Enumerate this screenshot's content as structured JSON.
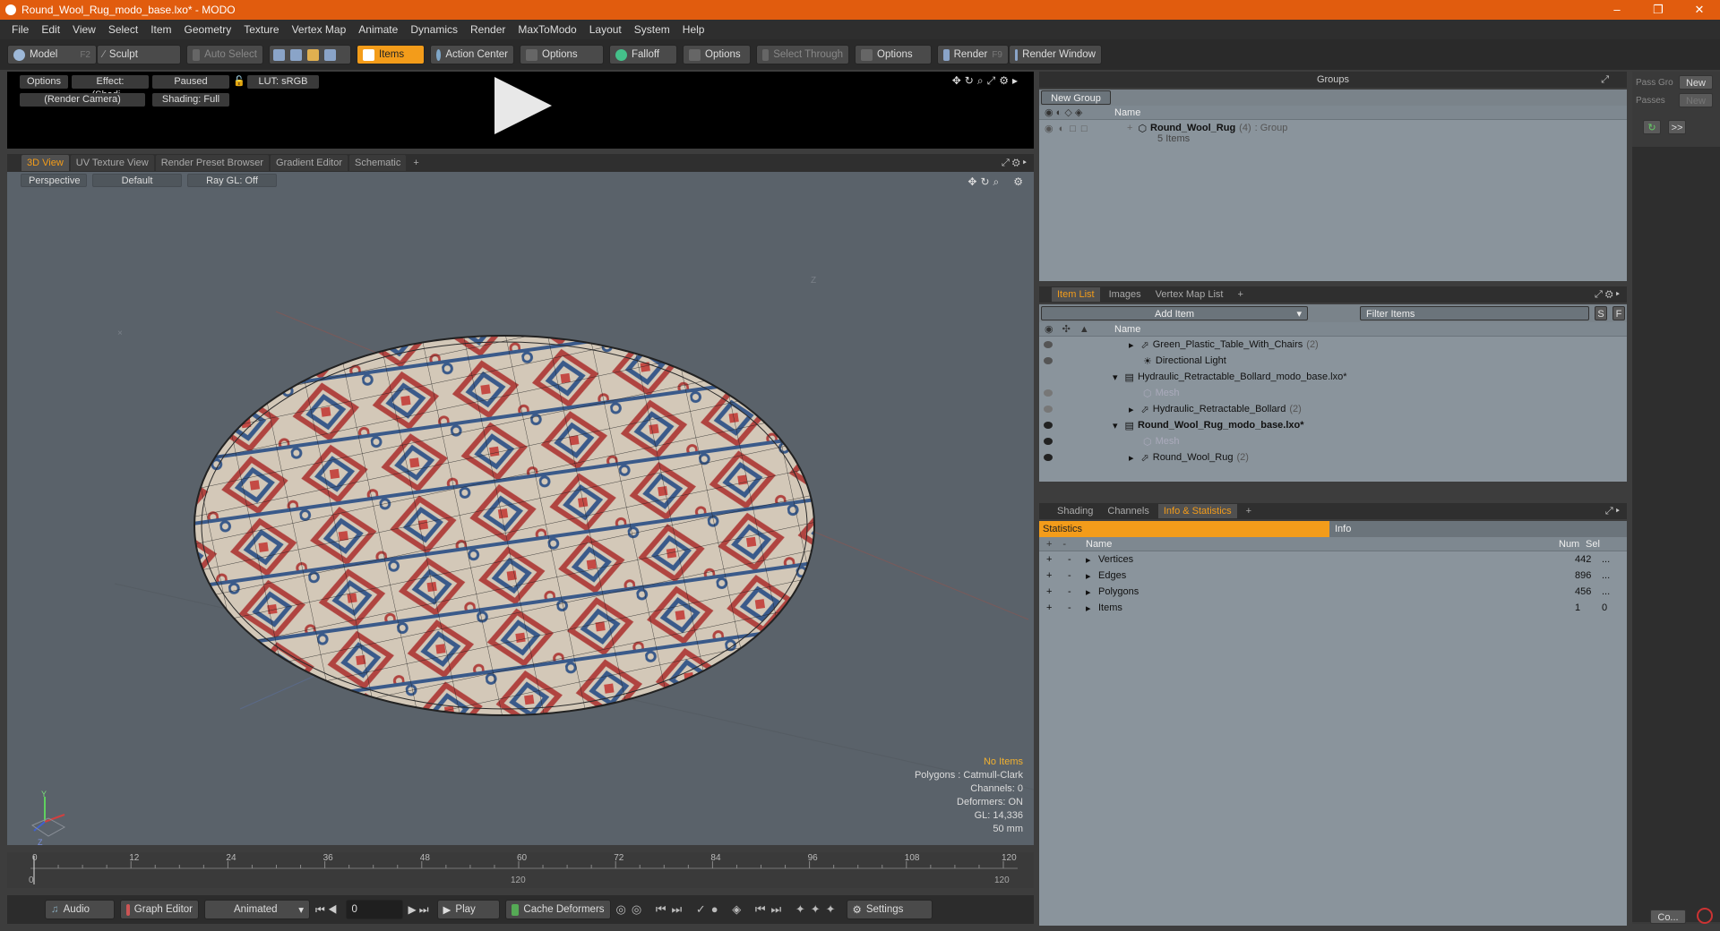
{
  "window": {
    "title": "Round_Wool_Rug_modo_base.lxo* - MODO",
    "minimize": "–",
    "maximize": "❐",
    "close": "✕"
  },
  "menu": [
    "File",
    "Edit",
    "View",
    "Select",
    "Item",
    "Geometry",
    "Texture",
    "Vertex Map",
    "Animate",
    "Dynamics",
    "Render",
    "MaxToModo",
    "Layout",
    "System",
    "Help"
  ],
  "toolbar": {
    "model": "Model",
    "model_key": "F2",
    "sculpt": "Sculpt",
    "auto_select": "Auto Select",
    "items": "Items",
    "action_center": "Action Center",
    "options1": "Options",
    "falloff": "Falloff",
    "options2": "Options",
    "select_through": "Select Through",
    "options3": "Options",
    "render": "Render",
    "render_key": "F9",
    "render_window": "Render Window"
  },
  "preview": {
    "options": "Options",
    "effect": "Effect: (Shadi...",
    "paused": "Paused",
    "lut": "LUT: sRGB",
    "camera": "(Render Camera)",
    "shading": "Shading: Full"
  },
  "viewport_tabs": [
    "3D View",
    "UV Texture View",
    "Render Preset Browser",
    "Gradient Editor",
    "Schematic",
    "+"
  ],
  "viewport": {
    "perspective": "Perspective",
    "default": "Default",
    "raygl": "Ray GL: Off",
    "info": {
      "no_items": "No Items",
      "polygons": "Polygons : Catmull-Clark",
      "channels": "Channels: 0",
      "deformers": "Deformers: ON",
      "gl": "GL: 14,336",
      "focal": "50 mm"
    },
    "axis_y": "Y",
    "axis_z": "Z"
  },
  "timeline": {
    "ticks": [
      "0",
      "12",
      "24",
      "36",
      "48",
      "60",
      "72",
      "84",
      "96",
      "108",
      "120"
    ],
    "start": "0",
    "mid": "120",
    "end": "120"
  },
  "playbar": {
    "audio": "Audio",
    "graph_editor": "Graph Editor",
    "animated": "Animated",
    "frame": "0",
    "play": "Play",
    "cache": "Cache Deformers",
    "settings": "Settings"
  },
  "groups": {
    "title": "Groups",
    "new_group": "New Group",
    "col_name": "Name",
    "row_name": "Round_Wool_Rug",
    "row_count": "(4)",
    "row_type": ": Group",
    "row_sub": "5 Items"
  },
  "pass": {
    "pass_groups": "Pass Gro",
    "passes": "Passes",
    "new1": "New",
    "new2": "New",
    "arrows": ">>",
    "co": "Co..."
  },
  "item_list": {
    "tabs": [
      "Item List",
      "Images",
      "Vertex Map List",
      "+"
    ],
    "add_item": "Add Item",
    "filter": "Filter Items",
    "s": "S",
    "f": "F",
    "col_name": "Name",
    "rows": [
      {
        "label": "Green_Plastic_Table_With_Chairs",
        "count": "(2)"
      },
      {
        "label": "Directional Light",
        "count": ""
      },
      {
        "label": "Hydraulic_Retractable_Bollard_modo_base.lxo*",
        "count": ""
      },
      {
        "label": "Mesh",
        "count": ""
      },
      {
        "label": "Hydraulic_Retractable_Bollard",
        "count": "(2)"
      },
      {
        "label": "Round_Wool_Rug_modo_base.lxo*",
        "count": ""
      },
      {
        "label": "Mesh",
        "count": ""
      },
      {
        "label": "Round_Wool_Rug",
        "count": "(2)"
      }
    ]
  },
  "stats_panel": {
    "tabs": [
      "Shading",
      "Channels",
      "Info & Statistics",
      "+"
    ],
    "statistics": "Statistics",
    "info": "Info",
    "col_name": "Name",
    "col_num": "Num",
    "col_sel": "Sel",
    "rows": [
      {
        "name": "Vertices",
        "num": "442",
        "sel": "..."
      },
      {
        "name": "Edges",
        "num": "896",
        "sel": "..."
      },
      {
        "name": "Polygons",
        "num": "456",
        "sel": "..."
      },
      {
        "name": "Items",
        "num": "1",
        "sel": "0"
      }
    ]
  },
  "colors": {
    "accent": "#f39c1a",
    "titlebar": "#e15c0e",
    "rug_red": "#b04440",
    "rug_blue": "#3a5a8a",
    "rug_cream": "#d8cfc2"
  }
}
